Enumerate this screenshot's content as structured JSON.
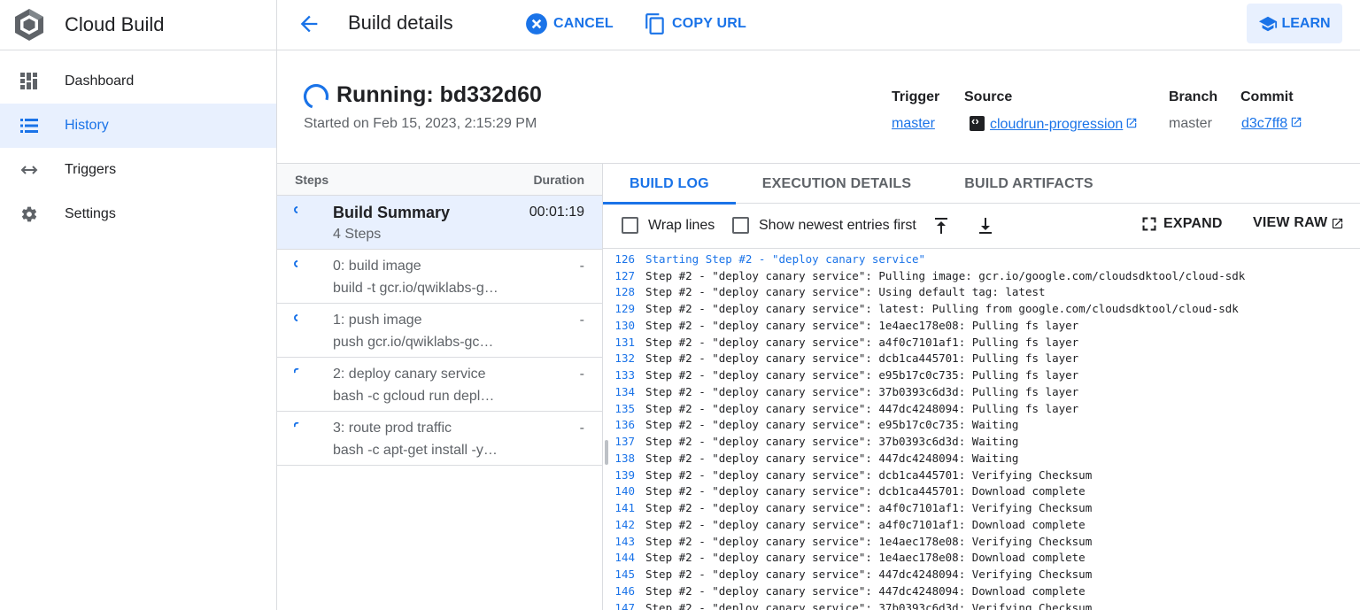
{
  "app": {
    "title": "Cloud Build"
  },
  "nav": [
    {
      "label": "Dashboard",
      "icon": "dashboard-icon"
    },
    {
      "label": "History",
      "icon": "list-icon",
      "active": true
    },
    {
      "label": "Triggers",
      "icon": "arrows-icon"
    },
    {
      "label": "Settings",
      "icon": "gear-icon"
    }
  ],
  "topbar": {
    "title": "Build details",
    "cancel_label": "CANCEL",
    "copy_label": "COPY URL",
    "learn_label": "LEARN"
  },
  "build": {
    "status_title": "Running: bd332d60",
    "started": "Started on Feb 15, 2023, 2:15:29 PM",
    "trigger_label": "Trigger",
    "trigger_value": "master",
    "source_label": "Source",
    "source_value": "cloudrun-progression",
    "branch_label": "Branch",
    "branch_value": "master",
    "commit_label": "Commit",
    "commit_value": "d3c7ff8"
  },
  "steps": {
    "header_steps": "Steps",
    "header_duration": "Duration",
    "items": [
      {
        "name": "Build Summary",
        "desc": "4 Steps",
        "duration": "00:01:19",
        "selected": true
      },
      {
        "name": "0: build image",
        "desc": "build -t gcr.io/qwiklabs-gcp-xxxx",
        "duration": "-"
      },
      {
        "name": "1: push image",
        "desc": "push gcr.io/qwiklabs-gcp-xxxx",
        "duration": "-"
      },
      {
        "name": "2: deploy canary service",
        "desc": "bash -c gcloud run deploy xxxx",
        "duration": "-"
      },
      {
        "name": "3: route prod traffic",
        "desc": "bash -c apt-get install -y jq xxxx",
        "duration": "-"
      }
    ]
  },
  "tabs": [
    "BUILD LOG",
    "EXECUTION DETAILS",
    "BUILD ARTIFACTS"
  ],
  "log_toolbar": {
    "wrap_label": "Wrap lines",
    "newest_label": "Show newest entries first",
    "expand_label": "EXPAND",
    "viewraw_label": "VIEW RAW"
  },
  "log": [
    {
      "n": "126",
      "t": "Starting Step #2 - \"deploy canary service\"",
      "hl": true
    },
    {
      "n": "127",
      "t": "Step #2 - \"deploy canary service\": Pulling image: gcr.io/google.com/cloudsdktool/cloud-sdk"
    },
    {
      "n": "128",
      "t": "Step #2 - \"deploy canary service\": Using default tag: latest"
    },
    {
      "n": "129",
      "t": "Step #2 - \"deploy canary service\": latest: Pulling from google.com/cloudsdktool/cloud-sdk"
    },
    {
      "n": "130",
      "t": "Step #2 - \"deploy canary service\": 1e4aec178e08: Pulling fs layer"
    },
    {
      "n": "131",
      "t": "Step #2 - \"deploy canary service\": a4f0c7101af1: Pulling fs layer"
    },
    {
      "n": "132",
      "t": "Step #2 - \"deploy canary service\": dcb1ca445701: Pulling fs layer"
    },
    {
      "n": "133",
      "t": "Step #2 - \"deploy canary service\": e95b17c0c735: Pulling fs layer"
    },
    {
      "n": "134",
      "t": "Step #2 - \"deploy canary service\": 37b0393c6d3d: Pulling fs layer"
    },
    {
      "n": "135",
      "t": "Step #2 - \"deploy canary service\": 447dc4248094: Pulling fs layer"
    },
    {
      "n": "136",
      "t": "Step #2 - \"deploy canary service\": e95b17c0c735: Waiting"
    },
    {
      "n": "137",
      "t": "Step #2 - \"deploy canary service\": 37b0393c6d3d: Waiting"
    },
    {
      "n": "138",
      "t": "Step #2 - \"deploy canary service\": 447dc4248094: Waiting"
    },
    {
      "n": "139",
      "t": "Step #2 - \"deploy canary service\": dcb1ca445701: Verifying Checksum"
    },
    {
      "n": "140",
      "t": "Step #2 - \"deploy canary service\": dcb1ca445701: Download complete"
    },
    {
      "n": "141",
      "t": "Step #2 - \"deploy canary service\": a4f0c7101af1: Verifying Checksum"
    },
    {
      "n": "142",
      "t": "Step #2 - \"deploy canary service\": a4f0c7101af1: Download complete"
    },
    {
      "n": "143",
      "t": "Step #2 - \"deploy canary service\": 1e4aec178e08: Verifying Checksum"
    },
    {
      "n": "144",
      "t": "Step #2 - \"deploy canary service\": 1e4aec178e08: Download complete"
    },
    {
      "n": "145",
      "t": "Step #2 - \"deploy canary service\": 447dc4248094: Verifying Checksum"
    },
    {
      "n": "146",
      "t": "Step #2 - \"deploy canary service\": 447dc4248094: Download complete"
    },
    {
      "n": "147",
      "t": "Step #2 - \"deploy canary service\": 37b0393c6d3d: Verifying Checksum"
    }
  ],
  "colors": {
    "accent": "#1a73e8",
    "active_bg": "#e8f0fe",
    "border": "#dadce0"
  }
}
